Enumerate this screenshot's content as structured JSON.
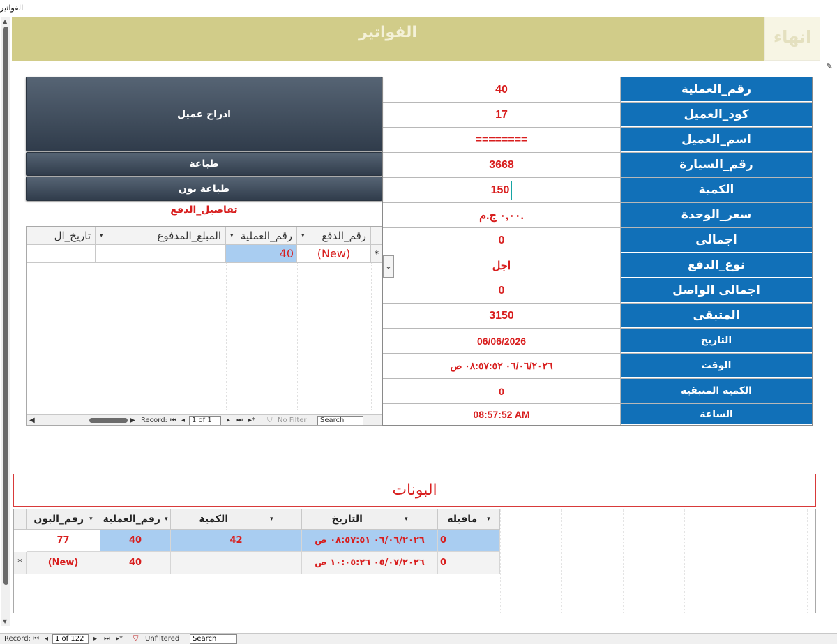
{
  "window": {
    "title": "الفواتير"
  },
  "header": {
    "title": "الفواتير",
    "finish_label": "انهاء"
  },
  "fields": [
    {
      "label": "رقم_العملية",
      "value": "40"
    },
    {
      "label": "كود_العميل",
      "value": "17"
    },
    {
      "label": "اسم_العميل",
      "value": "========"
    },
    {
      "label": "رقم_السيارة",
      "value": "3668"
    },
    {
      "label": "الكمية",
      "value": "150"
    },
    {
      "label": "سعر_الوحدة",
      "value": "٠,٠٠ ج.م."
    },
    {
      "label": "اجمالى",
      "value": "0"
    },
    {
      "label": "نوع_الدفع",
      "value": "اجل"
    },
    {
      "label": "اجمالى الواصل",
      "value": "0"
    },
    {
      "label": "المتبقى",
      "value": "3150"
    },
    {
      "label": "التاريخ",
      "value": "06/06/2026"
    },
    {
      "label": "الوقت",
      "value": "٠٦/٠٦/٢٠٢٦ ٠٨:٥٧:٥٢ ص"
    },
    {
      "label": "الكمية المتبقية",
      "value": "0"
    },
    {
      "label": "الساعة",
      "value": "08:57:52 AM"
    }
  ],
  "buttons": {
    "insert_customer": "ادراج عميل",
    "print": "طباعة",
    "print_bon": "طباعة بون"
  },
  "payments": {
    "title": "تفاصيل_الدفع",
    "columns": [
      "رقم_الدفع",
      "رقم_العملية",
      "المبلغ_المدفوع",
      "تاريخ_ال"
    ],
    "new_row": {
      "pay_no": "(New)",
      "op_no": "40",
      "amount": "",
      "date": ""
    },
    "nav": {
      "record_label": "Record:",
      "position": "1 of 1",
      "filter": "No Filter",
      "search": "Search"
    }
  },
  "bons": {
    "title": "البونات",
    "columns": [
      "ماقبله",
      "التاريخ",
      "الكمية",
      "رقم_العملية",
      "رقم_البون"
    ],
    "rows": [
      {
        "prev": "0",
        "date": "٠٦/٠٦/٢٠٢٦ ٠٨:٥٧:٥١ ص",
        "qty": "42",
        "op": "40",
        "bon": "77"
      },
      {
        "prev": "0",
        "date": "٠٥/٠٧/٢٠٢٦ ١٠:٠٥:٢٦ ص",
        "qty": "",
        "op": "40",
        "bon": "(New)"
      }
    ]
  },
  "record_nav": {
    "record_label": "Record:",
    "position": "1 of 122",
    "filter": "Unfiltered",
    "search": "Search"
  }
}
